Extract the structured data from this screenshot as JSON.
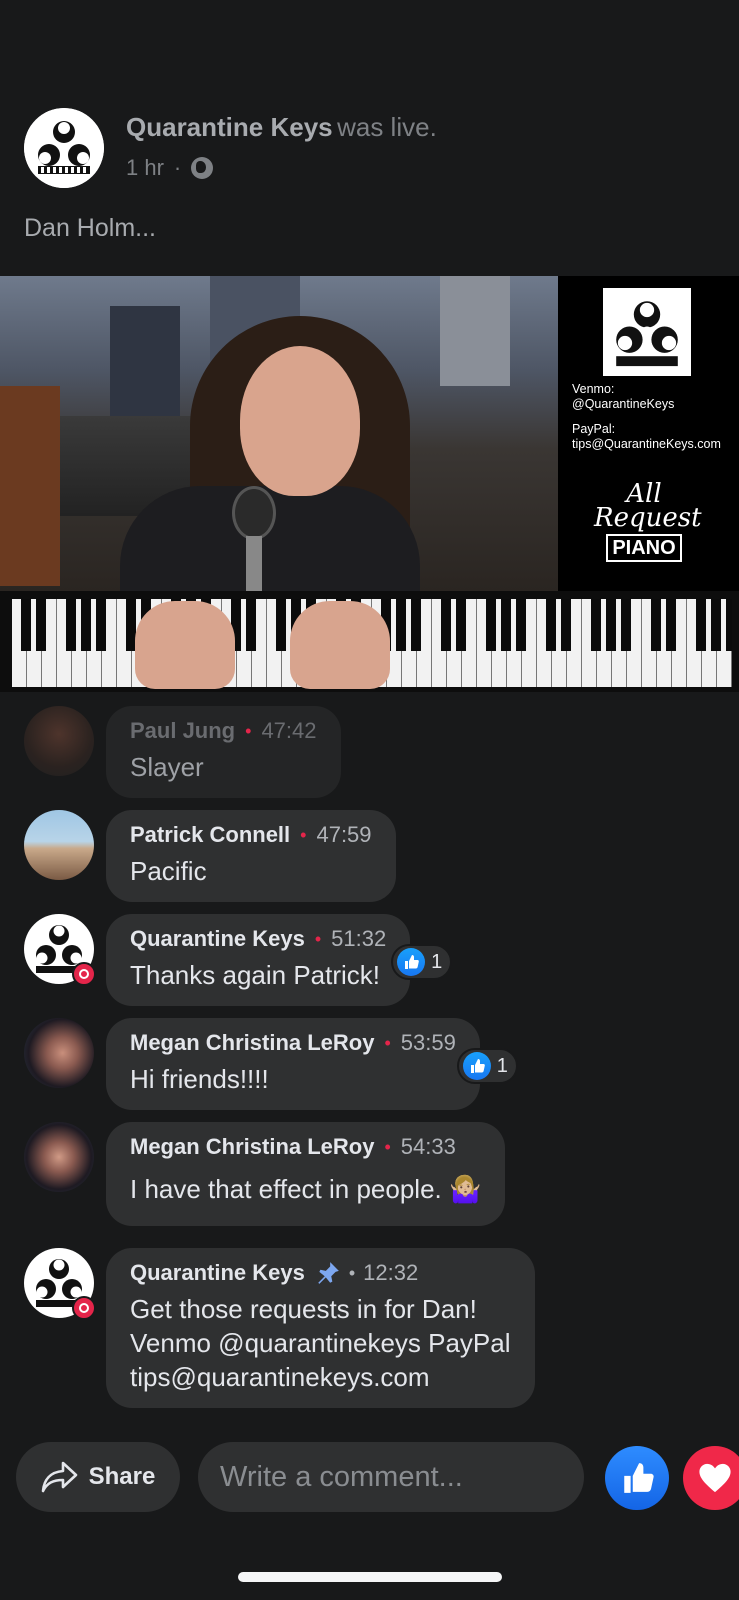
{
  "post": {
    "page_name": "Quarantine Keys",
    "status": "was live.",
    "time": "1 hr",
    "separator": "·",
    "privacy_icon": "globe-icon",
    "caption": "Dan Holm..."
  },
  "video": {
    "panel": {
      "venmo_label": "Venmo:",
      "venmo_handle": "@QuarantineKeys",
      "paypal_label": "PayPal:",
      "paypal_email": "tips@QuarantineKeys.com",
      "logo_line1": "All",
      "logo_line2": "Request",
      "logo_line3": "PIANO"
    }
  },
  "comments": [
    {
      "name": "Paul Jung",
      "time": "47:42",
      "text": "Slayer",
      "faded": true
    },
    {
      "name": "Patrick Connell",
      "time": "47:59",
      "text": "Pacific"
    },
    {
      "name": "Quarantine Keys",
      "time": "51:32",
      "text": "Thanks again Patrick!",
      "reactions": "1",
      "live_badge": true
    },
    {
      "name": "Megan Christina LeRoy",
      "time": "53:59",
      "text": "Hi friends!!!!",
      "reactions": "1"
    },
    {
      "name": "Megan Christina LeRoy",
      "time": "54:33",
      "text": "I have that effect in people. 🤷🏼‍♀️"
    },
    {
      "name": "Quarantine Keys",
      "time": "12:32",
      "text_lines": [
        "Get those requests in for Dan!",
        "Venmo @quarantinekeys PayPal",
        "tips@quarantinekeys.com"
      ],
      "pinned": true,
      "live_badge": true
    }
  ],
  "bottom_bar": {
    "share_label": "Share",
    "comment_placeholder": "Write a comment..."
  },
  "colors": {
    "background": "#18191a",
    "bubble": "#2f3031",
    "accent_red": "#e4254a",
    "like_blue": "#1877f2",
    "heart_red": "#f02849"
  }
}
